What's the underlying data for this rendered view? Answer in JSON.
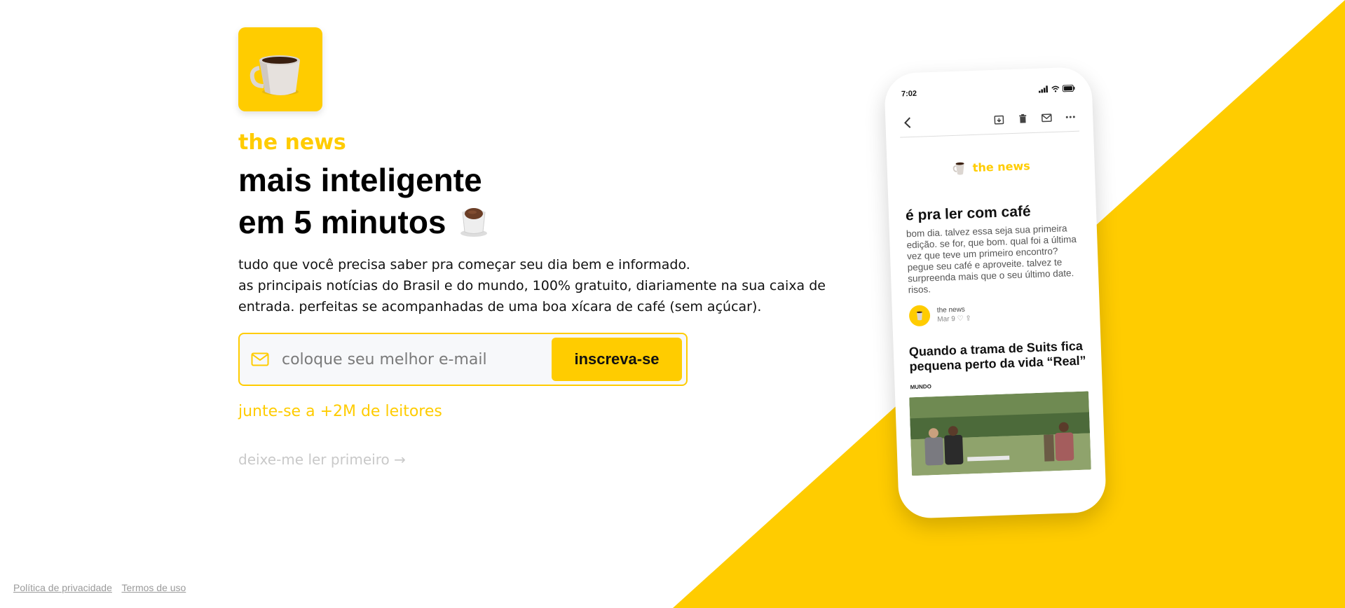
{
  "brand": {
    "name": "the news",
    "accent_color": "#FFCC00",
    "logo_icon": "coffee-mug-icon"
  },
  "hero": {
    "headline_line1": "mais inteligente",
    "headline_line2": "em 5 minutos",
    "headline_icon": "coffee-cup-icon",
    "description_line1": "tudo que você precisa saber pra começar seu dia bem e informado.",
    "description_line2": "as principais notícias do Brasil e do mundo, 100% gratuito, diariamente na sua caixa de entrada. perfeitas se acompanhadas de uma boa xícara de café (sem açúcar)."
  },
  "signup": {
    "email_placeholder": "coloque seu melhor e-mail",
    "email_value": "",
    "submit_label": "inscreva-se",
    "join_text": "junte-se a +2M de leitores",
    "read_first_label": "deixe-me ler primeiro →"
  },
  "footer": {
    "privacy": "Política de privacidade",
    "terms": "Termos de uso"
  },
  "phone": {
    "time": "7:02",
    "brand": "the news",
    "email_title": "é pra ler com café",
    "email_body": "bom dia. talvez essa seja sua primeira edição. se for, que bom. qual foi a última vez que teve um primeiro encontro? pegue seu café e aproveite. talvez te surpreenda mais que o seu último date. risos.",
    "author_name": "the news",
    "author_date": "Mar 9",
    "story_title": "Quando a trama de Suits fica pequena perto da vida “Real”",
    "story_section": "MUNDO"
  }
}
